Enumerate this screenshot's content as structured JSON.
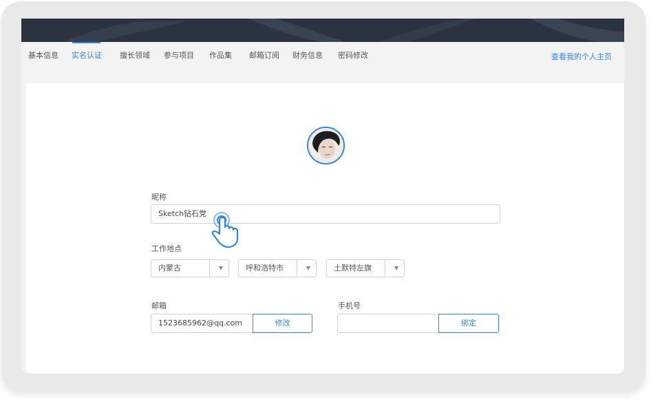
{
  "nav": {
    "items": [
      {
        "label": "基本信息",
        "active": false
      },
      {
        "label": "实名认证",
        "active": true
      },
      {
        "label": "擅长领域",
        "active": false
      },
      {
        "label": "参与项目",
        "active": false
      },
      {
        "label": "作品集",
        "active": false
      },
      {
        "label": "邮箱订阅",
        "active": false
      },
      {
        "label": "财务信息",
        "active": false
      },
      {
        "label": "密码修改",
        "active": false
      }
    ],
    "profile_link": "查看我的个人主页"
  },
  "form": {
    "nickname": {
      "label": "昵称",
      "value": "Sketch钻石党"
    },
    "work_location": {
      "label": "工作地点",
      "province": "内蒙古",
      "city": "呼和浩特市",
      "district": "土默特左旗"
    },
    "email": {
      "label": "邮箱",
      "value": "1523685962@qq.com",
      "button": "修改"
    },
    "phone": {
      "label": "手机号",
      "value": "",
      "button": "绑定"
    }
  },
  "icons": {
    "dropdown": "▼"
  },
  "colors": {
    "accent": "#2f86e8",
    "banner": "#2b3340",
    "background": "#f3f3f4"
  }
}
